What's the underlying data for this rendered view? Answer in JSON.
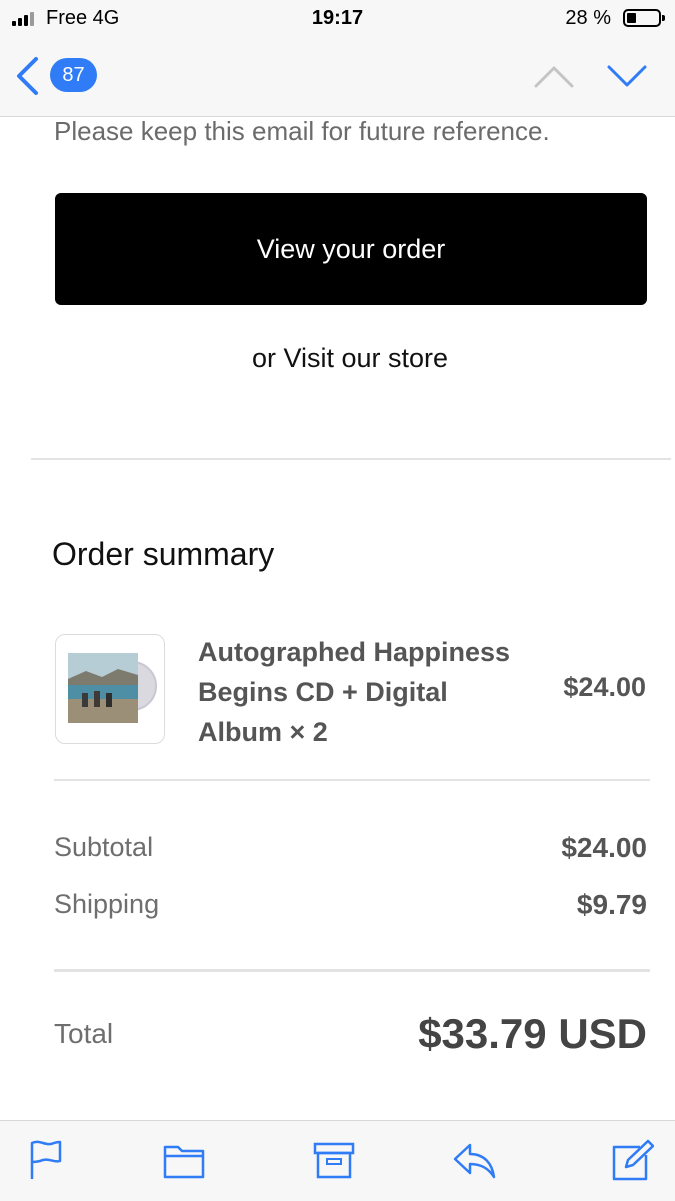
{
  "status_bar": {
    "carrier": "Free  4G",
    "time": "19:17",
    "battery": "28 %",
    "battery_level": 0.28
  },
  "nav": {
    "unread_count": "87",
    "icons": [
      "chevron-left-icon",
      "chevron-up-icon",
      "chevron-down-icon"
    ]
  },
  "email": {
    "keep_note": "Please keep this email for future reference.",
    "view_order_label": "View your order",
    "visit_store_label": "or Visit our store",
    "summary_title": "Order summary",
    "item": {
      "name": "Autographed Happiness Begins CD + Digital Album × 2",
      "price": "$24.00"
    },
    "subtotal_label": "Subtotal",
    "subtotal_value": "$24.00",
    "shipping_label": "Shipping",
    "shipping_value": "$9.79",
    "total_label": "Total",
    "total_value": "$33.79 USD"
  },
  "toolbar": {
    "icons": [
      "flag-icon",
      "folder-icon",
      "archive-icon",
      "reply-icon",
      "compose-icon"
    ]
  },
  "colors": {
    "accent": "#2f7cf6",
    "button_bg": "#000000",
    "muted_text": "#6e6e6e"
  }
}
